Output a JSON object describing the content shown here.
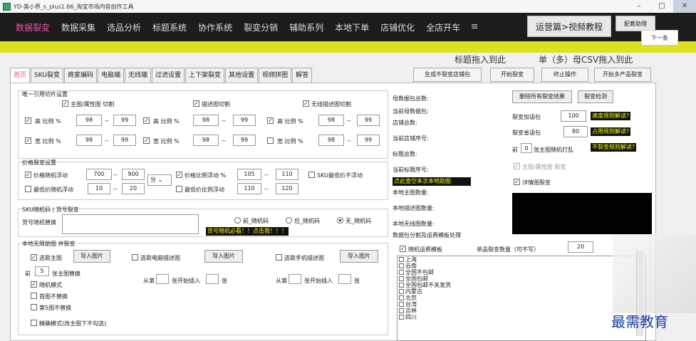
{
  "window": {
    "title": "YD-美小界_s_plus1.66_淘宝市场内容创作工具",
    "controls": {
      "minimize": "–",
      "maximize": "□",
      "close": "✕"
    }
  },
  "nav": {
    "items": [
      "数据裂变",
      "数据采集",
      "选品分析",
      "标题系统",
      "协作系统",
      "裂变分销",
      "辅助系列",
      "本地下单",
      "店铺优化",
      "全店开车"
    ],
    "menu_icon": "≡",
    "crumb": "运营篇>视频教程",
    "help": "配套助理",
    "next": "下一条"
  },
  "hints": {
    "drag_title": "标题拖入到此",
    "drag_csv": "单（多）母CSV拖入到此"
  },
  "tabs": [
    "首页",
    "SKU裂变",
    "商家编码",
    "电脑端",
    "无线端",
    "过滤设置",
    "上下架裂变",
    "其他设置",
    "视频拼图",
    "解答"
  ],
  "actions": {
    "gen_shop_pkg": "生成不裂变店铺包",
    "start_split": "开始裂变",
    "stop": "终止操作",
    "multi_split": "开始多产品裂变"
  },
  "image_cut": {
    "heading": "唯一引用切片设置",
    "main_label": "主图/属性图  切割",
    "desc_label": "描述图切割",
    "wireless_label": "无线描述图切割",
    "high_label": "高  比例 %",
    "wide_label": "宽  比例 %",
    "dash": "--",
    "values": {
      "low": "98",
      "high": "99"
    }
  },
  "price": {
    "heading": "价格裂变设置",
    "random_float": "价格随机浮动",
    "min_float": "最低价随机浮动",
    "ratio_float": "价格比例浮动 %",
    "min_ratio_float": "最低价比例浮动",
    "sku_min_nofloat": "SKU最低价不浮动",
    "v1": "700",
    "v2": "900",
    "unit": "分",
    "v3": "10",
    "v4": "20",
    "r1": "105",
    "r2": "110",
    "r3": "110",
    "r4": "120"
  },
  "sku_code": {
    "heading": "SKU随机码 | 货号裂变",
    "label": "货号随机替换",
    "opt_front": "前_随机码",
    "opt_back": "后_随机码",
    "opt_none": "无_随机码",
    "warn": "货号随机必看！！点击我！！！"
  },
  "local_img": {
    "heading": "本地无限助图  并裂变",
    "pick_main": "选取主图",
    "import": "导入图片",
    "pick_pc_desc": "选取电脑描述图",
    "pick_mobile_desc": "选取手机描述图",
    "front_label": "前",
    "front_value": "5",
    "front_suffix": "张主图替换",
    "random_mode": "随机模式",
    "first_no_replace": "首图不替换",
    "fifth_no_replace": "第5图不替换",
    "from_label": "从第",
    "start_insert": "张开始插入",
    "unit_zhang": "张",
    "precise_mode": "精确模式(改主图下不勾选)"
  },
  "right_info": {
    "mother_total": "母数据包总数:",
    "current_mother": "当前母数据包:",
    "shop_total": "店铺总数:",
    "current_shop_no": "当前店铺序号:",
    "title_total": "标题总数:",
    "current_title_no": "当前标题序号:",
    "click_view": "点此查空本次本地助图",
    "local_main_count": "本地主图数量:",
    "local_desc_count": "本地描述图数量:",
    "local_wireless_count": "本地无线图数量:",
    "template_heading": "数据包分割及运费模板处理",
    "del_results": "删除所有裂变结果",
    "split_detect": "裂变检测",
    "add_pkg": "裂变加语包",
    "add_pkg_val": "100",
    "split_pkg": "裂变省语包",
    "split_pkg_val": "80",
    "front_label": "前",
    "front_val": "0",
    "front_suffix": "张主图随机打乱",
    "main_attr_split": "主图/属性图  裂变",
    "detail_split": "详情图裂变",
    "speed_rule": "速度规则解读?",
    "ratio_rule": "占用规则解读?",
    "nosplit_rule": "不裂变规则解读?",
    "random_template": "随机运费模板",
    "single_split_count": "单品裂变数量（可不写）",
    "single_split_val": "20"
  },
  "regions": [
    "上海",
    "云南",
    "全国不包邮",
    "全国包邮",
    "全国包邮不关发货",
    "内蒙古",
    "北京",
    "台湾",
    "吉林",
    "四川"
  ],
  "watermark": "最需教育"
}
